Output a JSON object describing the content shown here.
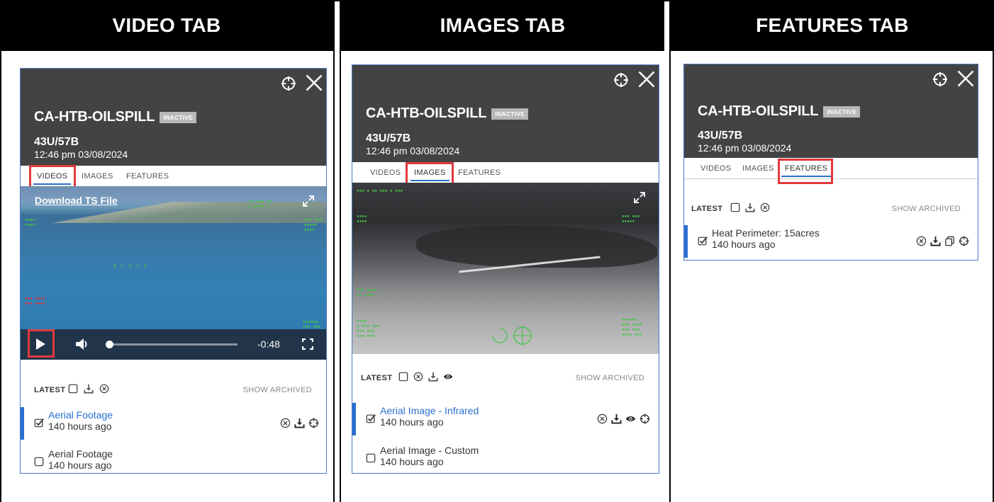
{
  "headers": {
    "video": "VIDEO TAB",
    "images": "IMAGES TAB",
    "features": "FEATURES TAB"
  },
  "panel": {
    "title": "CA-HTB-OILSPILL",
    "badge": "INACTIVE",
    "unit": "43U/57B",
    "timestamp": "12:46 pm 03/08/2024",
    "tabs": [
      "VIDEOS",
      "IMAGES",
      "FEATURES"
    ]
  },
  "video_panel": {
    "active_tab": "VIDEOS",
    "download_link": "Download TS File",
    "time_remaining": "-0:48",
    "progress": 0.0,
    "latest_label": "LATEST",
    "show_archived": "SHOW ARCHIVED",
    "items": [
      {
        "name": "Aerial Footage",
        "ago": "140 hours ago",
        "selected": true
      },
      {
        "name": "Aerial Footage",
        "ago": "140 hours ago",
        "selected": false
      }
    ]
  },
  "images_panel": {
    "active_tab": "IMAGES",
    "latest_label": "LATEST",
    "show_archived": "SHOW ARCHIVED",
    "items": [
      {
        "name": "Aerial Image - Infrared",
        "ago": "140 hours ago",
        "selected": true
      },
      {
        "name": "Aerial Image - Custom",
        "ago": "140 hours ago",
        "selected": false
      }
    ]
  },
  "features_panel": {
    "active_tab": "FEATURES",
    "latest_label": "LATEST",
    "show_archived": "SHOW ARCHIVED",
    "items": [
      {
        "name": "Heat Perimeter: 15acres",
        "ago": "140 hours ago",
        "selected": true
      }
    ]
  },
  "colors": {
    "accent": "#2a6fd1",
    "header_bg": "#434343",
    "highlight": "#e0393b"
  },
  "icons": [
    "target-icon",
    "close-icon",
    "checkbox-icon",
    "download-icon",
    "remove-icon",
    "eye-icon",
    "copy-icon",
    "play-icon",
    "volume-icon",
    "fullscreen-icon",
    "expand-icon"
  ]
}
